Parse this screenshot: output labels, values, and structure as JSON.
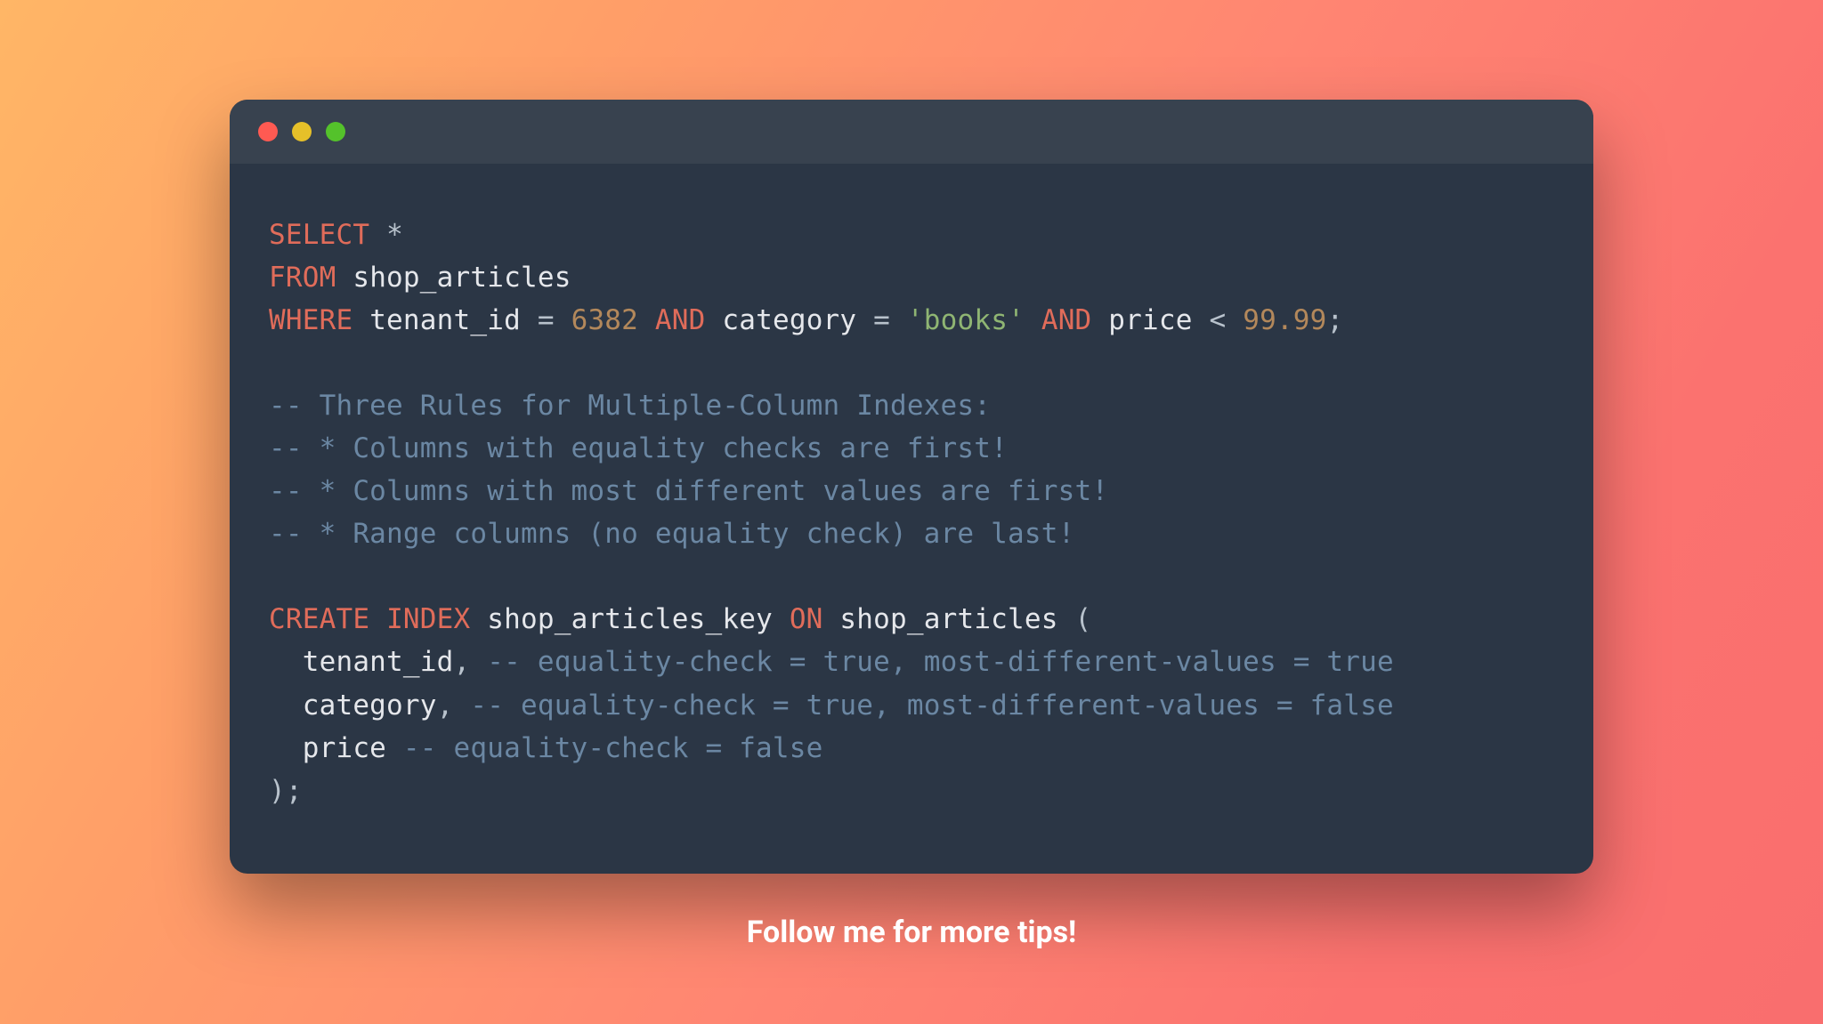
{
  "dots": {
    "close": "#ff5a52",
    "minimize": "#e6c029",
    "zoom": "#54c22b"
  },
  "colors": {
    "keyword": "#e06c5a",
    "number": "#b3885b",
    "string": "#8fb573",
    "comment": "#6b87a3",
    "plain": "#e5e7eb",
    "punct": "#b8c2cc"
  },
  "footer": "Follow me for more tips!",
  "code": [
    [
      [
        "keyword",
        "SELECT"
      ],
      [
        "plain",
        " "
      ],
      [
        "punct",
        "*"
      ]
    ],
    [
      [
        "keyword",
        "FROM"
      ],
      [
        "plain",
        " shop_articles"
      ]
    ],
    [
      [
        "keyword",
        "WHERE"
      ],
      [
        "plain",
        " tenant_id "
      ],
      [
        "punct",
        "="
      ],
      [
        "plain",
        " "
      ],
      [
        "number",
        "6382"
      ],
      [
        "plain",
        " "
      ],
      [
        "keyword",
        "AND"
      ],
      [
        "plain",
        " category "
      ],
      [
        "punct",
        "="
      ],
      [
        "plain",
        " "
      ],
      [
        "string",
        "'books'"
      ],
      [
        "plain",
        " "
      ],
      [
        "keyword",
        "AND"
      ],
      [
        "plain",
        " price "
      ],
      [
        "punct",
        "<"
      ],
      [
        "plain",
        " "
      ],
      [
        "number",
        "99.99"
      ],
      [
        "punct",
        ";"
      ]
    ],
    [],
    [
      [
        "comment",
        "-- Three Rules for Multiple-Column Indexes:"
      ]
    ],
    [
      [
        "comment",
        "-- * Columns with equality checks are first!"
      ]
    ],
    [
      [
        "comment",
        "-- * Columns with most different values are first!"
      ]
    ],
    [
      [
        "comment",
        "-- * Range columns (no equality check) are last!"
      ]
    ],
    [],
    [
      [
        "keyword",
        "CREATE"
      ],
      [
        "plain",
        " "
      ],
      [
        "keyword",
        "INDEX"
      ],
      [
        "plain",
        " shop_articles_key "
      ],
      [
        "keyword",
        "ON"
      ],
      [
        "plain",
        " shop_articles "
      ],
      [
        "punct",
        "("
      ]
    ],
    [
      [
        "plain",
        "  tenant_id"
      ],
      [
        "punct",
        ","
      ],
      [
        "plain",
        " "
      ],
      [
        "comment",
        "-- equality-check = true, most-different-values = true"
      ]
    ],
    [
      [
        "plain",
        "  category"
      ],
      [
        "punct",
        ","
      ],
      [
        "plain",
        " "
      ],
      [
        "comment",
        "-- equality-check = true, most-different-values = false"
      ]
    ],
    [
      [
        "plain",
        "  price "
      ],
      [
        "comment",
        "-- equality-check = false"
      ]
    ],
    [
      [
        "punct",
        ")"
      ],
      [
        "punct",
        ";"
      ]
    ]
  ]
}
